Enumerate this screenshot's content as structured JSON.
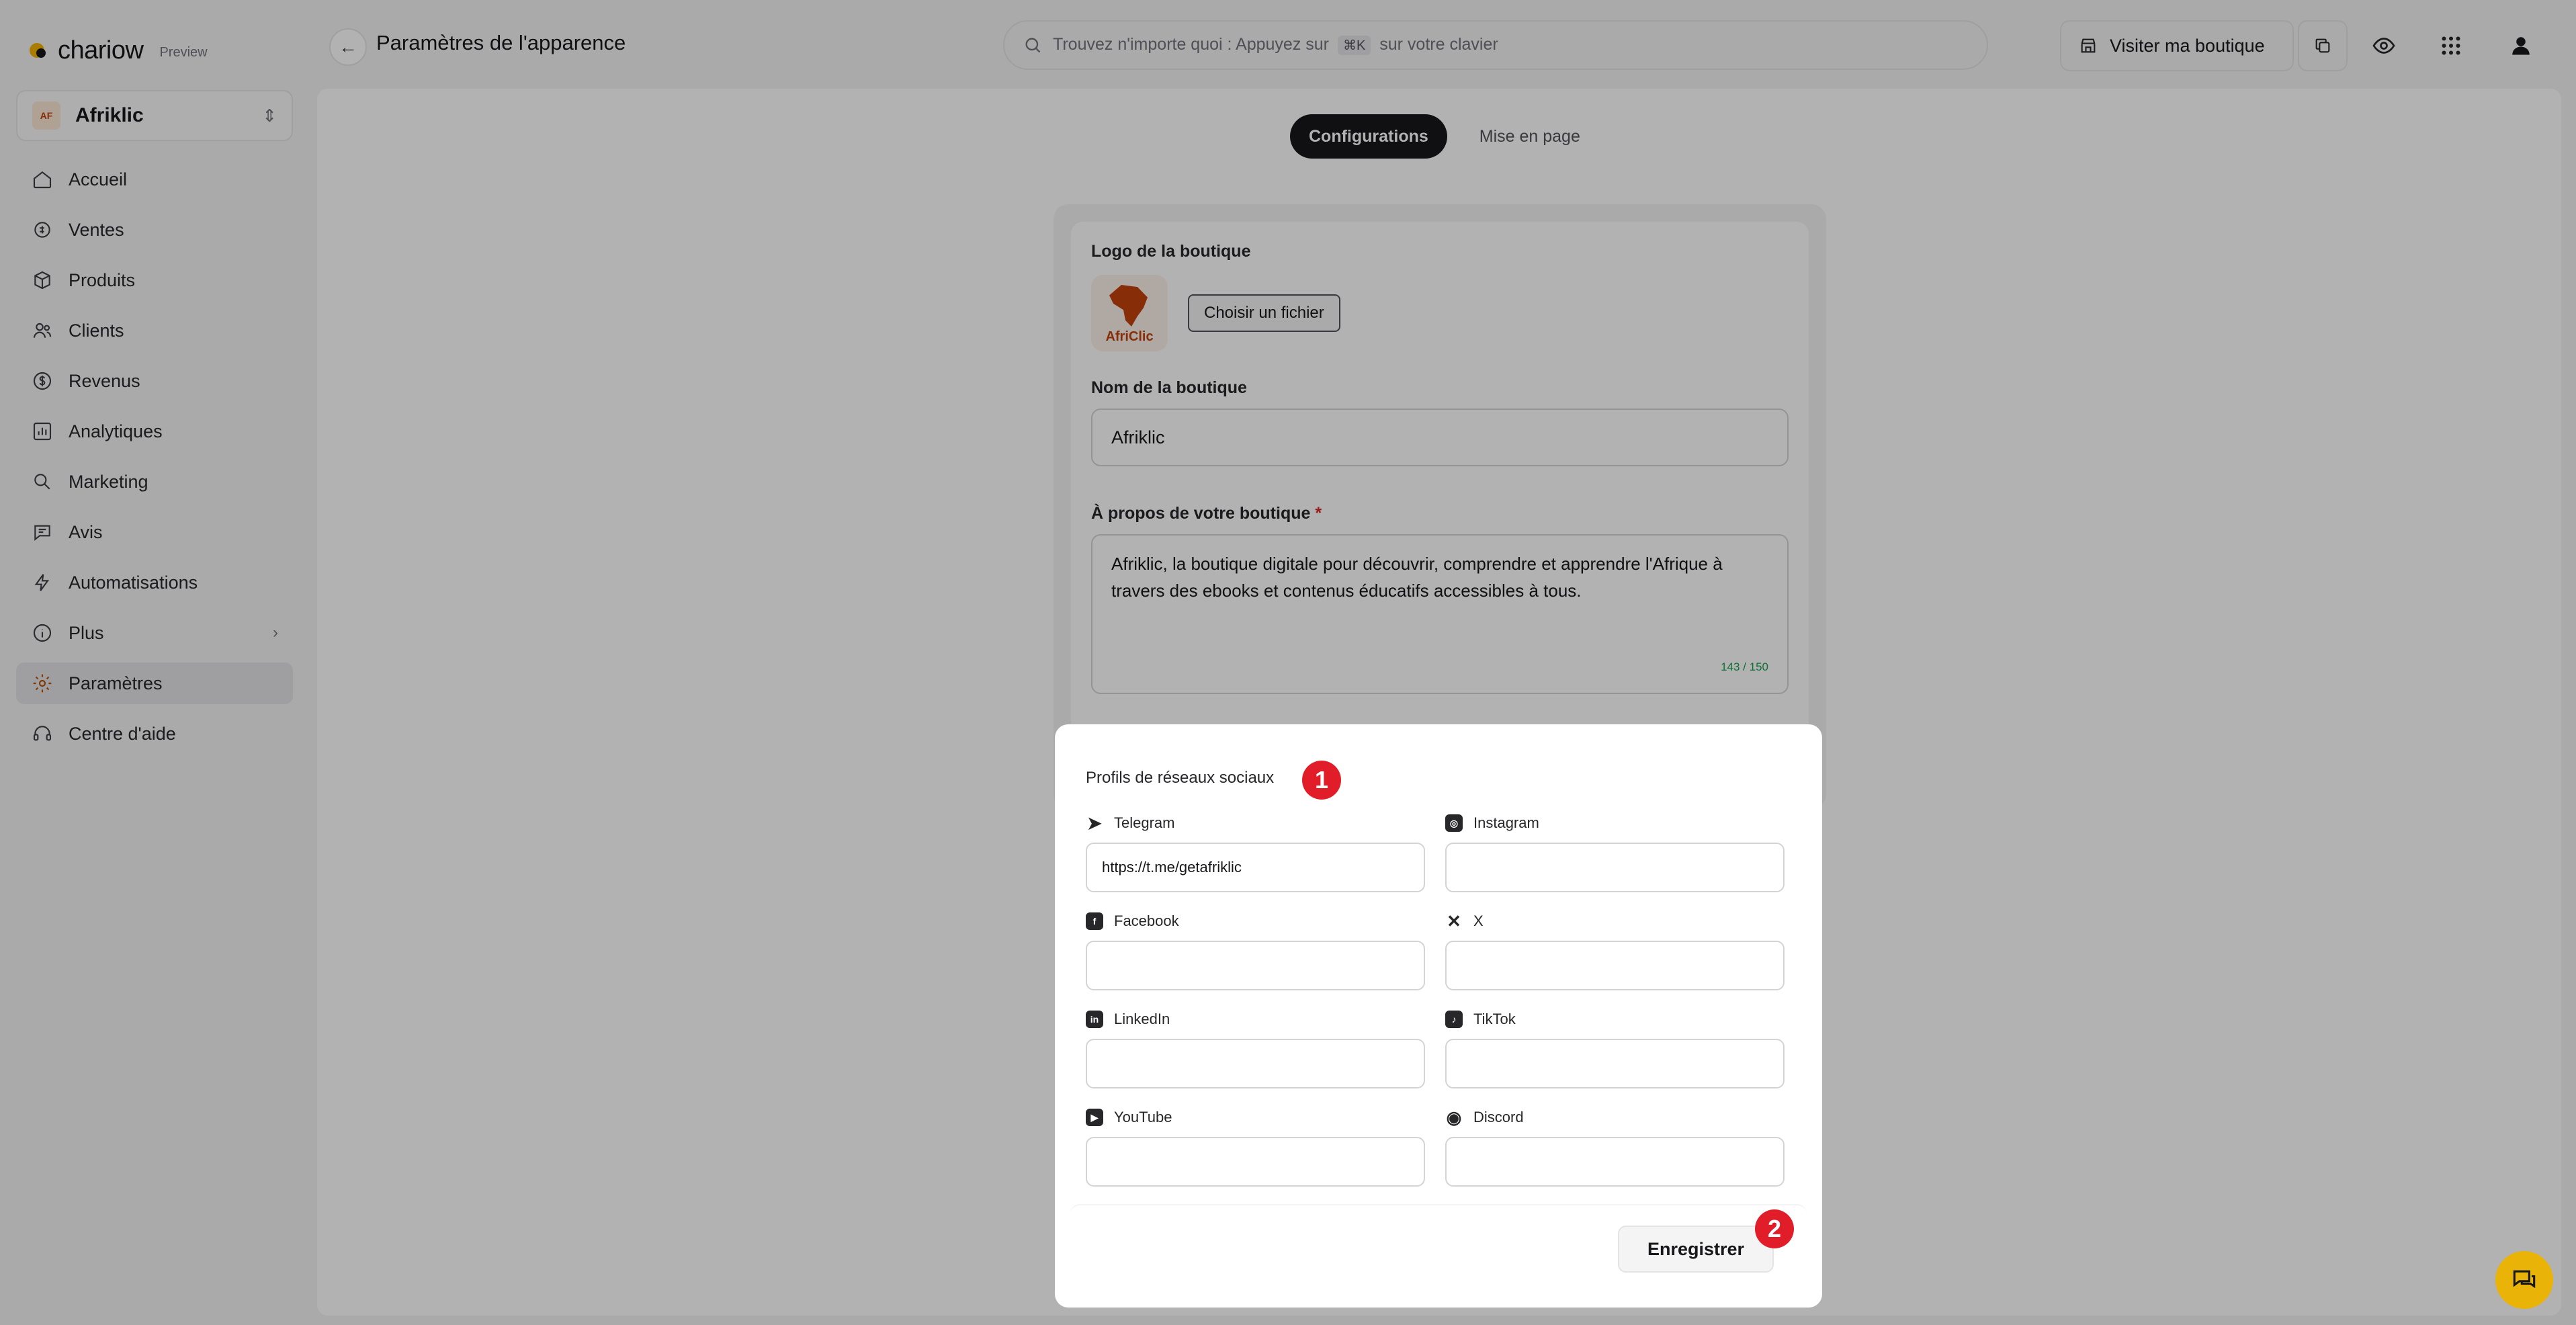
{
  "brand": {
    "name": "chariow",
    "tag": "Preview"
  },
  "shop": {
    "name": "Afriklic",
    "logo_text": "AfriClic"
  },
  "nav": [
    {
      "label": "Accueil",
      "icon": "home-icon"
    },
    {
      "label": "Ventes",
      "icon": "sales-icon"
    },
    {
      "label": "Produits",
      "icon": "box-icon"
    },
    {
      "label": "Clients",
      "icon": "users-icon"
    },
    {
      "label": "Revenus",
      "icon": "dollar-icon"
    },
    {
      "label": "Analytiques",
      "icon": "chart-icon"
    },
    {
      "label": "Marketing",
      "icon": "megaphone-icon"
    },
    {
      "label": "Avis",
      "icon": "review-icon"
    },
    {
      "label": "Automatisations",
      "icon": "bolt-icon"
    },
    {
      "label": "Plus",
      "icon": "info-icon"
    },
    {
      "label": "Paramètres",
      "icon": "gear-icon"
    },
    {
      "label": "Centre d'aide",
      "icon": "headset-icon"
    }
  ],
  "header": {
    "title": "Paramètres de l'apparence",
    "search_prefix": "Trouvez n'importe quoi : Appuyez sur",
    "search_kbd": "⌘K",
    "search_suffix": "sur votre clavier",
    "visit_label": "Visiter ma boutique"
  },
  "tabs": [
    {
      "label": "Configurations",
      "active": true
    },
    {
      "label": "Mise en page",
      "active": false
    }
  ],
  "config": {
    "logo_label": "Logo de la boutique",
    "file_button": "Choisir un fichier",
    "name_label": "Nom de la boutique",
    "name_value": "Afriklic",
    "about_label": "À propos de votre boutique",
    "about_required": "*",
    "about_value": "Afriklic, la boutique digitale pour découvrir, comprendre et apprendre l'Afrique à travers des ebooks et contenus éducatifs accessibles à tous.",
    "about_counter": "143 / 150"
  },
  "social": {
    "title": "Profils de réseaux sociaux",
    "badge": "1",
    "fields": [
      {
        "label": "Telegram",
        "icon": "telegram-icon",
        "value": "https://t.me/getafriklic"
      },
      {
        "label": "Instagram",
        "icon": "instagram-icon",
        "value": ""
      },
      {
        "label": "Facebook",
        "icon": "facebook-icon",
        "value": ""
      },
      {
        "label": "X",
        "icon": "x-icon",
        "value": ""
      },
      {
        "label": "LinkedIn",
        "icon": "linkedin-icon",
        "value": ""
      },
      {
        "label": "TikTok",
        "icon": "tiktok-icon",
        "value": ""
      },
      {
        "label": "YouTube",
        "icon": "youtube-icon",
        "value": ""
      },
      {
        "label": "Discord",
        "icon": "discord-icon",
        "value": ""
      }
    ]
  },
  "save": {
    "label": "Enregistrer",
    "badge": "2"
  },
  "colors": {
    "accent": "#18181b",
    "badge": "#e11d2a",
    "counter": "#16a34a",
    "chat": "#eab308",
    "brand_dot": "#f4b400"
  }
}
